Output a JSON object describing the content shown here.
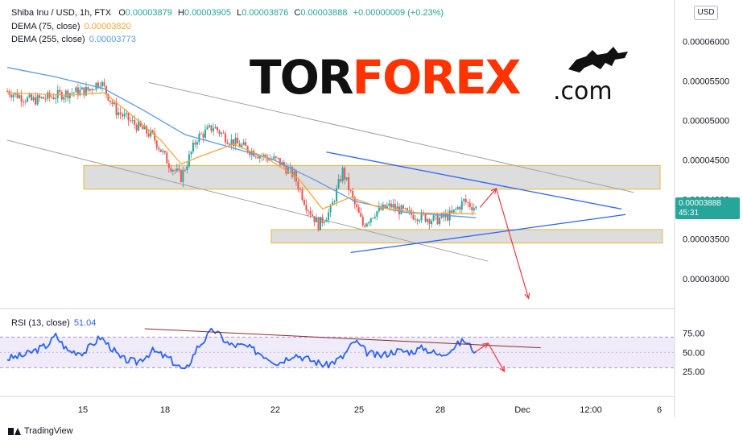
{
  "header": {
    "symbol_line": "Shiba Inu / USD, 1h, FTX",
    "open_key": "O",
    "open_val": "0.00003879",
    "high_key": "H",
    "high_val": "0.00003905",
    "low_key": "L",
    "low_val": "0.00003876",
    "close_key": "C",
    "close_val": "0.00003888",
    "change": "+0.00000009 (+0.23%)",
    "dema75_label": "DEMA (75, close)",
    "dema75_val": "0.00003820",
    "dema255_label": "DEMA (255, close)",
    "dema255_val": "0.00003773",
    "rsi_label": "RSI (13, close)",
    "rsi_val": "51.04"
  },
  "currency": "USD",
  "price_tag": {
    "price": "0.00003888",
    "countdown": "45:31"
  },
  "watermark": {
    "tor": "TOR",
    "forex": "FOREX",
    "com": ".com"
  },
  "footer": {
    "brand": "TradingView"
  },
  "colors": {
    "up": "#26a69a",
    "down": "#ef5350",
    "dema75": "#f7a43a",
    "dema255": "#5b9ce6",
    "rsi": "#2962ff",
    "rsi_band": "#7e57c2",
    "trend": "#2962ff",
    "arrow": "#f23645",
    "zone": "#f0b43c"
  },
  "chart_data": [
    {
      "type": "candlestick",
      "title": "Shiba Inu / USD, 1h, FTX",
      "x_ticks": [
        "15",
        "18",
        "22",
        "25",
        "28",
        "Dec",
        "12:00",
        "6"
      ],
      "y_ticks": [
        "0.00006000",
        "0.00005500",
        "0.00005000",
        "0.00004500",
        "0.00004000",
        "0.00003500",
        "0.00003000"
      ],
      "ylim": [
        2.733e-05,
        6.217e-05
      ],
      "close_path": [
        {
          "t": 0,
          "v": 5.37e-05
        },
        {
          "t": 6,
          "v": 5.25e-05
        },
        {
          "t": 11,
          "v": 5.3e-05
        },
        {
          "t": 15,
          "v": 5.35e-05
        },
        {
          "t": 20,
          "v": 5.38e-05
        },
        {
          "t": 23,
          "v": 5.5e-05
        },
        {
          "t": 27,
          "v": 5.12e-05
        },
        {
          "t": 31,
          "v": 4.97e-05
        },
        {
          "t": 36,
          "v": 4.8e-05
        },
        {
          "t": 40,
          "v": 4.45e-05
        },
        {
          "t": 43,
          "v": 4.28e-05
        },
        {
          "t": 47,
          "v": 4.78e-05
        },
        {
          "t": 51,
          "v": 4.92e-05
        },
        {
          "t": 55,
          "v": 4.75e-05
        },
        {
          "t": 59,
          "v": 4.65e-05
        },
        {
          "t": 63,
          "v": 4.55e-05
        },
        {
          "t": 67,
          "v": 4.49e-05
        },
        {
          "t": 71,
          "v": 4.3e-05
        },
        {
          "t": 74,
          "v": 3.93e-05
        },
        {
          "t": 77,
          "v": 3.68e-05
        },
        {
          "t": 80,
          "v": 3.86e-05
        },
        {
          "t": 83,
          "v": 4.36e-05
        },
        {
          "t": 86,
          "v": 3.93e-05
        },
        {
          "t": 88,
          "v": 3.68e-05
        },
        {
          "t": 91,
          "v": 3.84e-05
        },
        {
          "t": 95,
          "v": 3.92e-05
        },
        {
          "t": 99,
          "v": 3.82e-05
        },
        {
          "t": 102,
          "v": 3.79e-05
        },
        {
          "t": 106,
          "v": 3.74e-05
        },
        {
          "t": 110,
          "v": 3.81e-05
        },
        {
          "t": 113,
          "v": 3.98e-05
        },
        {
          "t": 116,
          "v": 3.89e-05
        }
      ],
      "dema75": [
        {
          "t": 0,
          "v": 5.35e-05
        },
        {
          "t": 15,
          "v": 5.32e-05
        },
        {
          "t": 24,
          "v": 5.35e-05
        },
        {
          "t": 30,
          "v": 5.1e-05
        },
        {
          "t": 38,
          "v": 4.75e-05
        },
        {
          "t": 43,
          "v": 4.45e-05
        },
        {
          "t": 48,
          "v": 4.55e-05
        },
        {
          "t": 56,
          "v": 4.7e-05
        },
        {
          "t": 64,
          "v": 4.53e-05
        },
        {
          "t": 72,
          "v": 4.27e-05
        },
        {
          "t": 78,
          "v": 3.88e-05
        },
        {
          "t": 85,
          "v": 4.03e-05
        },
        {
          "t": 92,
          "v": 3.9e-05
        },
        {
          "t": 102,
          "v": 3.83e-05
        },
        {
          "t": 116,
          "v": 3.82e-05
        }
      ],
      "dema255": [
        {
          "t": 0,
          "v": 5.67e-05
        },
        {
          "t": 12,
          "v": 5.55e-05
        },
        {
          "t": 24,
          "v": 5.4e-05
        },
        {
          "t": 34,
          "v": 5.12e-05
        },
        {
          "t": 44,
          "v": 4.82e-05
        },
        {
          "t": 56,
          "v": 4.65e-05
        },
        {
          "t": 66,
          "v": 4.5e-05
        },
        {
          "t": 76,
          "v": 4.25e-05
        },
        {
          "t": 86,
          "v": 3.98e-05
        },
        {
          "t": 98,
          "v": 3.84e-05
        },
        {
          "t": 116,
          "v": 3.77e-05
        }
      ],
      "zones": [
        {
          "from": 4.13e-05,
          "to": 4.43e-05
        },
        {
          "from": 3.45e-05,
          "to": 3.62e-05
        }
      ],
      "lines": [
        {
          "name": "channel-upper",
          "p1": {
            "t": 35,
            "v": 5.48e-05
          },
          "p2": {
            "t": 155,
            "v": 4.09e-05
          }
        },
        {
          "name": "channel-lower",
          "p1": {
            "t": 0,
            "v": 4.75e-05
          },
          "p2": {
            "t": 119,
            "v": 3.22e-05
          }
        },
        {
          "name": "triangle-upper",
          "p1": {
            "t": 79,
            "v": 4.6e-05
          },
          "p2": {
            "t": 152,
            "v": 3.88e-05
          }
        },
        {
          "name": "triangle-lower",
          "p1": {
            "t": 85,
            "v": 3.33e-05
          },
          "p2": {
            "t": 153,
            "v": 3.81e-05
          }
        }
      ],
      "arrows": [
        {
          "from": {
            "t": 117,
            "v": 3.9e-05
          },
          "to": {
            "t": 121,
            "v": 4.14e-05
          }
        },
        {
          "from": {
            "t": 121,
            "v": 4.14e-05
          },
          "to": {
            "t": 129,
            "v": 2.75e-05
          }
        }
      ]
    },
    {
      "type": "line",
      "title": "RSI (13, close)",
      "y_ticks": [
        "75.00",
        "50.00",
        "25.00"
      ],
      "ylim": [
        5,
        100
      ],
      "bands": [
        30,
        70
      ],
      "values": [
        {
          "t": 0,
          "v": 42
        },
        {
          "t": 4,
          "v": 46
        },
        {
          "t": 8,
          "v": 55
        },
        {
          "t": 10,
          "v": 60
        },
        {
          "t": 12,
          "v": 72
        },
        {
          "t": 15,
          "v": 52
        },
        {
          "t": 19,
          "v": 50
        },
        {
          "t": 23,
          "v": 70
        },
        {
          "t": 26,
          "v": 55
        },
        {
          "t": 28,
          "v": 42
        },
        {
          "t": 32,
          "v": 37
        },
        {
          "t": 36,
          "v": 52
        },
        {
          "t": 40,
          "v": 42
        },
        {
          "t": 44,
          "v": 25
        },
        {
          "t": 47,
          "v": 56
        },
        {
          "t": 51,
          "v": 80
        },
        {
          "t": 55,
          "v": 60
        },
        {
          "t": 59,
          "v": 58
        },
        {
          "t": 63,
          "v": 48
        },
        {
          "t": 67,
          "v": 36
        },
        {
          "t": 71,
          "v": 48
        },
        {
          "t": 75,
          "v": 40
        },
        {
          "t": 79,
          "v": 33
        },
        {
          "t": 83,
          "v": 44
        },
        {
          "t": 86,
          "v": 65
        },
        {
          "t": 89,
          "v": 50
        },
        {
          "t": 92,
          "v": 45
        },
        {
          "t": 96,
          "v": 52
        },
        {
          "t": 100,
          "v": 51
        },
        {
          "t": 103,
          "v": 56
        },
        {
          "t": 107,
          "v": 46
        },
        {
          "t": 110,
          "v": 55
        },
        {
          "t": 113,
          "v": 66
        },
        {
          "t": 116,
          "v": 51
        }
      ],
      "trendline": {
        "p1": {
          "t": 34,
          "v": 81
        },
        "p2": {
          "t": 132,
          "v": 56
        }
      },
      "arrows": [
        {
          "from": {
            "t": 116,
            "v": 51
          },
          "to": {
            "t": 119,
            "v": 62
          }
        },
        {
          "from": {
            "t": 119,
            "v": 62
          },
          "to": {
            "t": 123,
            "v": 25
          }
        }
      ]
    }
  ]
}
